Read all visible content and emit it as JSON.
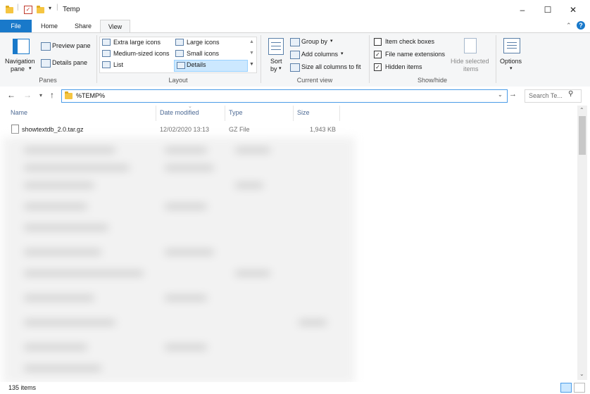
{
  "window": {
    "title": "Temp",
    "minimize": "–",
    "maximize": "☐",
    "close": "✕"
  },
  "tabs": [
    "File",
    "Home",
    "Share",
    "View"
  ],
  "ribbon": {
    "panes": {
      "navigation_pane": "Navigation",
      "navigation_pane_line2": "pane",
      "preview_pane": "Preview pane",
      "details_pane": "Details pane",
      "label": "Panes"
    },
    "layout": {
      "items": [
        "Extra large icons",
        "Large icons",
        "Medium-sized icons",
        "Small icons",
        "List",
        "Details"
      ],
      "selected": "Details",
      "label": "Layout"
    },
    "current_view": {
      "sort_by": "Sort",
      "sort_by_line2": "by",
      "group_by": "Group by",
      "add_columns": "Add columns",
      "size_all": "Size all columns to fit",
      "label": "Current view"
    },
    "show_hide": {
      "item_check_boxes": "Item check boxes",
      "file_name_extensions": "File name extensions",
      "hidden_items": "Hidden items",
      "hide_selected": "Hide selected",
      "hide_selected_line2": "items",
      "label": "Show/hide"
    },
    "options": {
      "label": "Options"
    }
  },
  "address": {
    "value": "%TEMP%",
    "search_placeholder": "Search Te..."
  },
  "columns": [
    "Name",
    "Date modified",
    "Type",
    "Size"
  ],
  "files": [
    {
      "name": "showtextdb_2.0.tar.gz",
      "date": "12/02/2020 13:13",
      "type": "GZ File",
      "size": "1,943 KB"
    }
  ],
  "status": {
    "count": "135 items"
  },
  "colors": {
    "accent": "#1979ca",
    "selection": "#cce8ff",
    "header_text": "#4d6a94"
  }
}
